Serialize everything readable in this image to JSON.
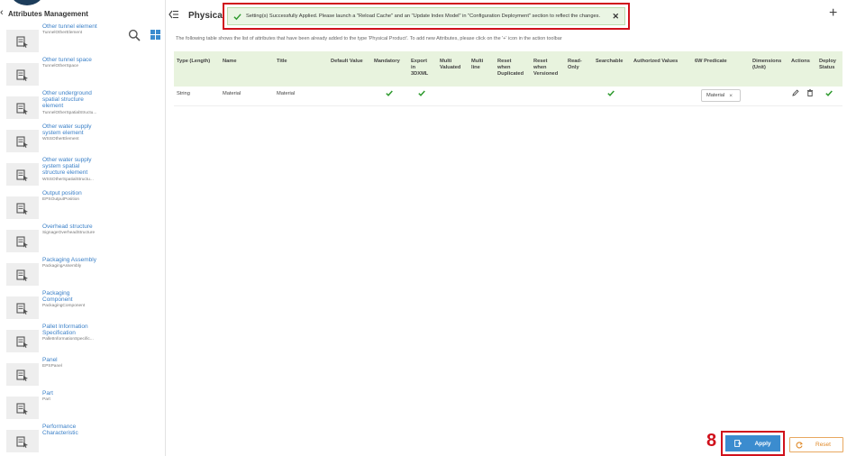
{
  "sidebar": {
    "title": "Attributes Management",
    "items": [
      {
        "name": "Other tunnel element",
        "code": "TunnelOtherElement"
      },
      {
        "name": "Other tunnel space",
        "code": "TunnelOtherSpace"
      },
      {
        "name": "Other underground\nspatial structure\nelement",
        "code": "TunnelOtherSpatialStructu..."
      },
      {
        "name": "Other water supply\nsystem element",
        "code": "WSSOtherElement"
      },
      {
        "name": "Other water supply\nsystem spatial\nstructure element",
        "code": "WSSOtherSpatialStructu..."
      },
      {
        "name": "Output position",
        "code": "EPSOutputPosition"
      },
      {
        "name": "Overhead structure",
        "code": "SignageOverheadStructure"
      },
      {
        "name": "Packaging Assembly",
        "code": "PackagingAssembly"
      },
      {
        "name": "Packaging\nComponent",
        "code": "PackagingComponent"
      },
      {
        "name": "Pallet Information\nSpecification",
        "code": "PalletInformationSpecific..."
      },
      {
        "name": "Panel",
        "code": "EPSPanel"
      },
      {
        "name": "Part",
        "code": "Part"
      },
      {
        "name": "Performance\nCharacteristic",
        "code": ""
      }
    ]
  },
  "header": {
    "title": "Physical",
    "plus": "+"
  },
  "toast": {
    "message": "Setting(s) Successfully Applied. Please launch a \"Reload Cache\" and an \"Update Index Model\" in \"Configuration Deployment\" section to reflect the changes.",
    "close": "✕"
  },
  "description": "The following table shows the list of attributes that have been already added to the type 'Physical Product'. To add new Attributes, please click on the '+' icon in the action toolbar",
  "table": {
    "headers": {
      "type": "Type (Length)",
      "name": "Name",
      "title": "Title",
      "default_value": "Default Value",
      "mandatory": "Mandatory",
      "export": "Export\nin\n3DXML",
      "multi_valued": "Multi\nValuated",
      "multi_line": "Multi\nline",
      "reset_dup": "Reset\nwhen\nDuplicated",
      "reset_ver": "Reset\nwhen\nVersioned",
      "read_only": "Read-\nOnly",
      "searchable": "Searchable",
      "authorized": "Authorized Values",
      "predicate": "6W Predicate",
      "dimensions": "Dimensions\n(Unit)",
      "actions": "Actions",
      "deploy": "Deploy\nStatus"
    },
    "row": {
      "type": "String",
      "name": "Material",
      "title": "Material",
      "predicate_tag": "Material",
      "tag_remove": "×"
    }
  },
  "footer": {
    "step": "8",
    "apply_label": "Apply",
    "reset_label": "Reset"
  },
  "icons": {
    "item": "attribute-type-icon",
    "search": "search-icon",
    "grid": "grid-view-icon",
    "collapse": "collapse-sidebar-icon",
    "edit": "pencil-icon",
    "delete": "trash-icon",
    "check": "check-icon"
  },
  "colors": {
    "accent": "#3b8ccf",
    "success": "#2e9a2e",
    "highlight": "#d0111c",
    "reset": "#e08a2a"
  }
}
